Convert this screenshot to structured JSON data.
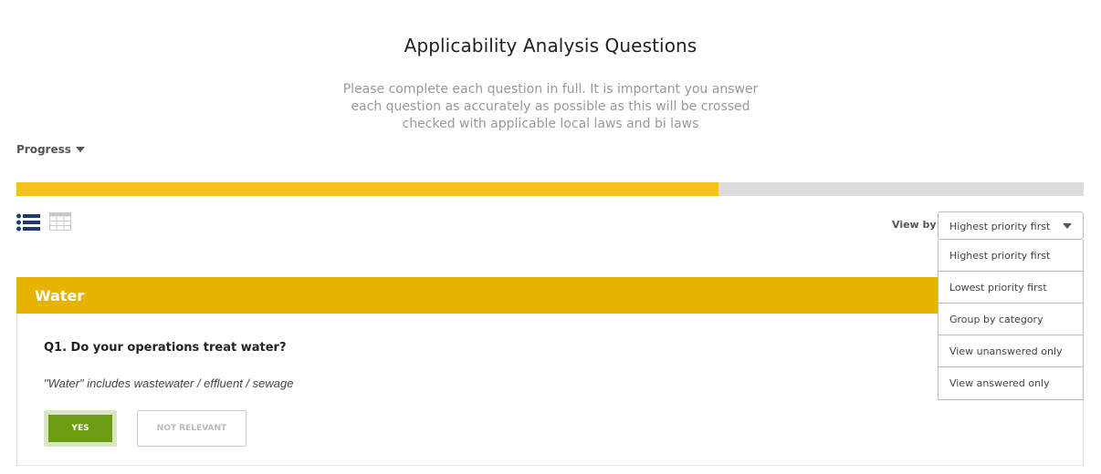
{
  "page": {
    "title": "Applicability Analysis Questions",
    "intro": "Please complete each question in full. It is important you answer each question as accurately as possible as this will be crossed checked with applicable local laws and bi laws"
  },
  "progress": {
    "label": "Progress",
    "fraction": 0.658,
    "fill_color": "#f5c11a",
    "track_color": "#dcdcdc"
  },
  "view_toggle": {
    "icons": [
      "list-icon",
      "grid-icon"
    ],
    "active": "list-icon",
    "active_color": "#1f3a6e"
  },
  "view_by": {
    "label": "View by:",
    "selected": "Highest priority first",
    "options": [
      "Highest priority first",
      "Lowest priority first",
      "Group by category",
      "View unanswered only",
      "View answered only"
    ]
  },
  "category": {
    "title": "Water",
    "color": "#e6b400",
    "question": {
      "text": "Q1. Do your operations treat water?",
      "note": "\"Water\" includes wastewater / effluent / sewage",
      "yes_label": "YES",
      "not_relevant_label": "NOT RELEVANT",
      "selected": "YES"
    }
  }
}
